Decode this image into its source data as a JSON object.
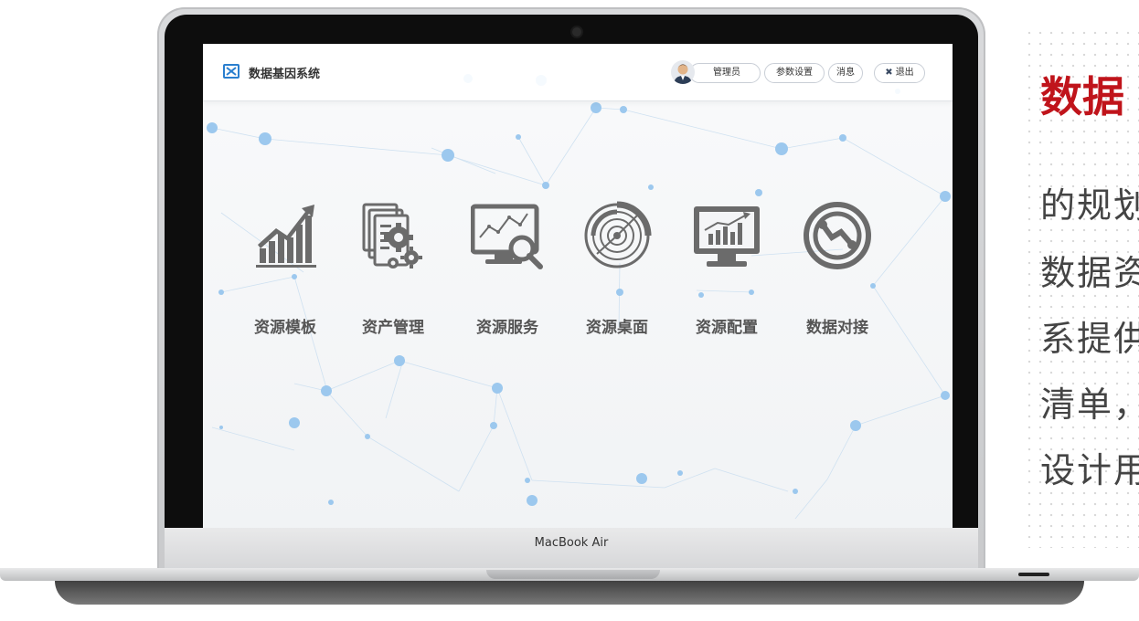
{
  "side_text": {
    "title": "数据",
    "lines": [
      "的规划",
      "数据资",
      "系提供",
      "清单，",
      "设计用"
    ]
  },
  "device": {
    "brand": "MacBook Air"
  },
  "app": {
    "title": "数据基因系统",
    "nav": {
      "user": "管理员",
      "params": "参数设置",
      "messages": "消息",
      "logout": "退出"
    },
    "modules": [
      {
        "label": "资源模板",
        "icon": "growth-chart-icon"
      },
      {
        "label": "资产管理",
        "icon": "documents-gears-icon"
      },
      {
        "label": "资源服务",
        "icon": "monitor-search-icon"
      },
      {
        "label": "资源桌面",
        "icon": "radar-icon"
      },
      {
        "label": "资源配置",
        "icon": "monitor-barchart-icon"
      },
      {
        "label": "数据对接",
        "icon": "connector-icon"
      }
    ]
  },
  "colors": {
    "accent": "#c0141b",
    "icon_gray": "#6b6b6b",
    "node_blue": "#9cc8ee"
  }
}
